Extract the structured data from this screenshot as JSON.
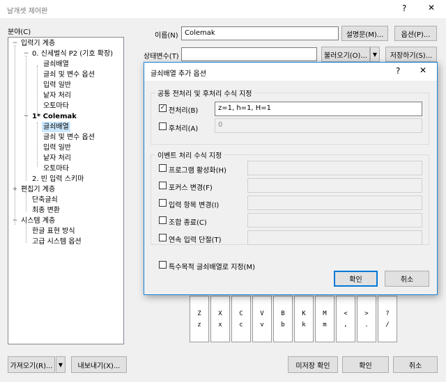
{
  "window": {
    "title": "날개셋 제어판",
    "help_glyph": "?",
    "close_glyph": "✕"
  },
  "sidebar": {
    "label": "분야(C)",
    "tree": [
      {
        "label": "입력기 계층",
        "toggle": "−"
      },
      {
        "label": "0. 신세벌식 P2 (기호 확장)",
        "toggle": "−"
      },
      {
        "label": "글쇠배열"
      },
      {
        "label": "글쇠 및 변수 옵션"
      },
      {
        "label": "입력 일반"
      },
      {
        "label": "낱자 처리"
      },
      {
        "label": "오토마타"
      },
      {
        "label": "1* Colemak",
        "toggle": "−"
      },
      {
        "label": "글쇠배열"
      },
      {
        "label": "글쇠 및 변수 옵션"
      },
      {
        "label": "입력 일반"
      },
      {
        "label": "낱자 처리"
      },
      {
        "label": "오토마타"
      },
      {
        "label": "2. 빈 입력 스키마"
      },
      {
        "label": "편집기 계층",
        "toggle": "+"
      },
      {
        "label": "단축글쇠"
      },
      {
        "label": "최종 변환"
      },
      {
        "label": "시스템 계층",
        "toggle": "−"
      },
      {
        "label": "한글 표현 방식"
      },
      {
        "label": "고급 시스템 옵션"
      }
    ]
  },
  "main": {
    "name_label": "이름(N)",
    "name_value": "Colemak",
    "desc_button": "설명문(M)...",
    "options_button": "옵션(P)...",
    "state_label": "상태변수(T)",
    "state_value": "",
    "load_button": "불러오기(O)...",
    "save_button": "저장하기(S)...",
    "keys": [
      {
        "top": "Z",
        "bottom": "z"
      },
      {
        "top": "X",
        "bottom": "x"
      },
      {
        "top": "C",
        "bottom": "c"
      },
      {
        "top": "V",
        "bottom": "v"
      },
      {
        "top": "B",
        "bottom": "b"
      },
      {
        "top": "K",
        "bottom": "k"
      },
      {
        "top": "M",
        "bottom": "m"
      },
      {
        "top": "<",
        "bottom": ","
      },
      {
        "top": ">",
        "bottom": "."
      },
      {
        "top": "?",
        "bottom": "/"
      }
    ]
  },
  "footer": {
    "import_button": "가져오기(R)...",
    "export_button": "내보내기(X)...",
    "unsaved_button": "미저장 확인",
    "ok_button": "확인",
    "cancel_button": "취소"
  },
  "dialog": {
    "title": "글쇠배열 추가 옵션",
    "help_glyph": "?",
    "close_glyph": "✕",
    "group1_title": "공통 전처리 및 후처리 수식 지정",
    "pre_label": "전처리(B)",
    "pre_checked": true,
    "pre_value": "z=1, h=1, H=1",
    "post_label": "후처리(A)",
    "post_checked": false,
    "post_value": "0",
    "group2_title": "이벤트 처리 수식 지정",
    "events": [
      {
        "label": "프로그램 활성화(H)"
      },
      {
        "label": "포커스 변경(F)"
      },
      {
        "label": "입력 항목 변경(I)"
      },
      {
        "label": "조합 종료(C)"
      },
      {
        "label": "연속 입력 단절(T)"
      }
    ],
    "special_label": "특수목적 글쇠배열로 지정(M)",
    "ok_button": "확인",
    "cancel_button": "취소"
  }
}
